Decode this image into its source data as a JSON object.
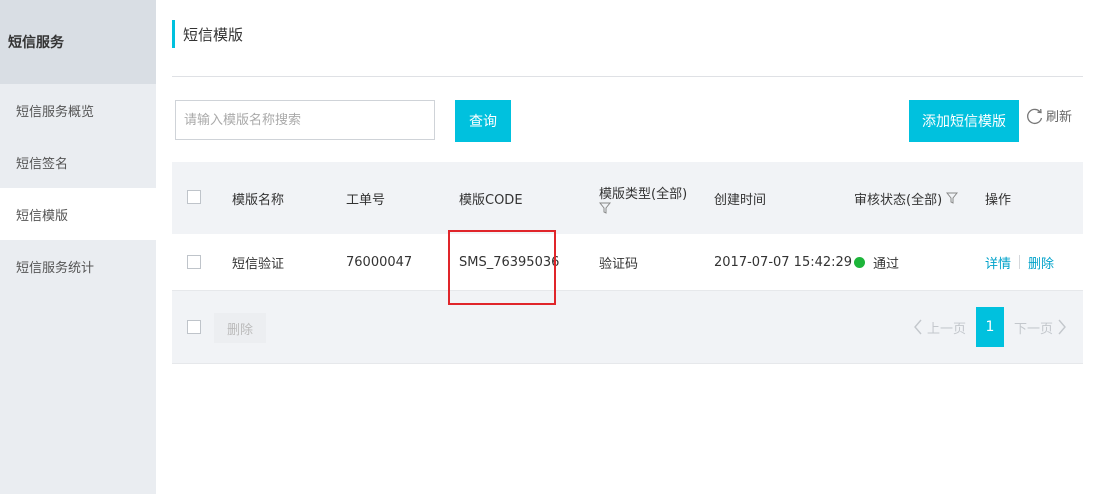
{
  "sidebar": {
    "header": "短信服务",
    "items": [
      {
        "label": "短信服务概览",
        "active": false
      },
      {
        "label": "短信签名",
        "active": false
      },
      {
        "label": "短信模版",
        "active": true
      },
      {
        "label": "短信服务统计",
        "active": false
      }
    ]
  },
  "page": {
    "title": "短信模版"
  },
  "toolbar": {
    "search_placeholder": "请输入模版名称搜索",
    "search_value": "",
    "query_label": "查询",
    "add_label": "添加短信模版",
    "refresh_label": "刷新"
  },
  "table": {
    "headers": {
      "name": "模版名称",
      "ticket": "工单号",
      "code": "模版CODE",
      "type": "模版类型(全部)",
      "created": "创建时间",
      "status": "审核状态(全部)",
      "ops": "操作"
    },
    "rows": [
      {
        "name": "短信验证",
        "ticket": "76000047",
        "code": "SMS_76395036",
        "type": "验证码",
        "created": "2017-07-07 15:42:29",
        "status": "通过",
        "status_color": "#1db53a",
        "op_detail": "详情",
        "op_delete": "删除"
      }
    ],
    "footer": {
      "delete_label": "删除",
      "prev_label": "上一页",
      "next_label": "下一页",
      "current_page": "1"
    }
  },
  "colors": {
    "accent": "#00c1de",
    "link": "#00a2ca",
    "highlight": "#e0252a"
  }
}
